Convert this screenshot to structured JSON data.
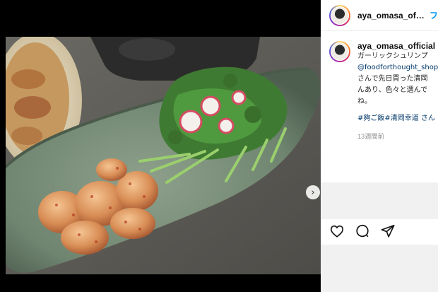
{
  "post": {
    "username": "aya_omasa_officia",
    "follow_label": "フ",
    "caption_user": "aya_omasa_official",
    "caption_lines": [
      "ガーリックシュリンプ",
      "@foodforthought_shop",
      "さんで先日買った清岡",
      "んあり、色々と選んで",
      "ね。"
    ],
    "hashtags": "#夠ご飯#清岡幸道 さん",
    "time_ago": "13週間前"
  },
  "carousel": {
    "next_symbol": "›",
    "dots": 2,
    "active_dot": 0
  },
  "actions": [
    "heart-icon",
    "comment-icon",
    "share-icon"
  ],
  "colors": {
    "follow": "#0095f6",
    "mention": "#00376b",
    "muted": "#8e8e8e"
  }
}
